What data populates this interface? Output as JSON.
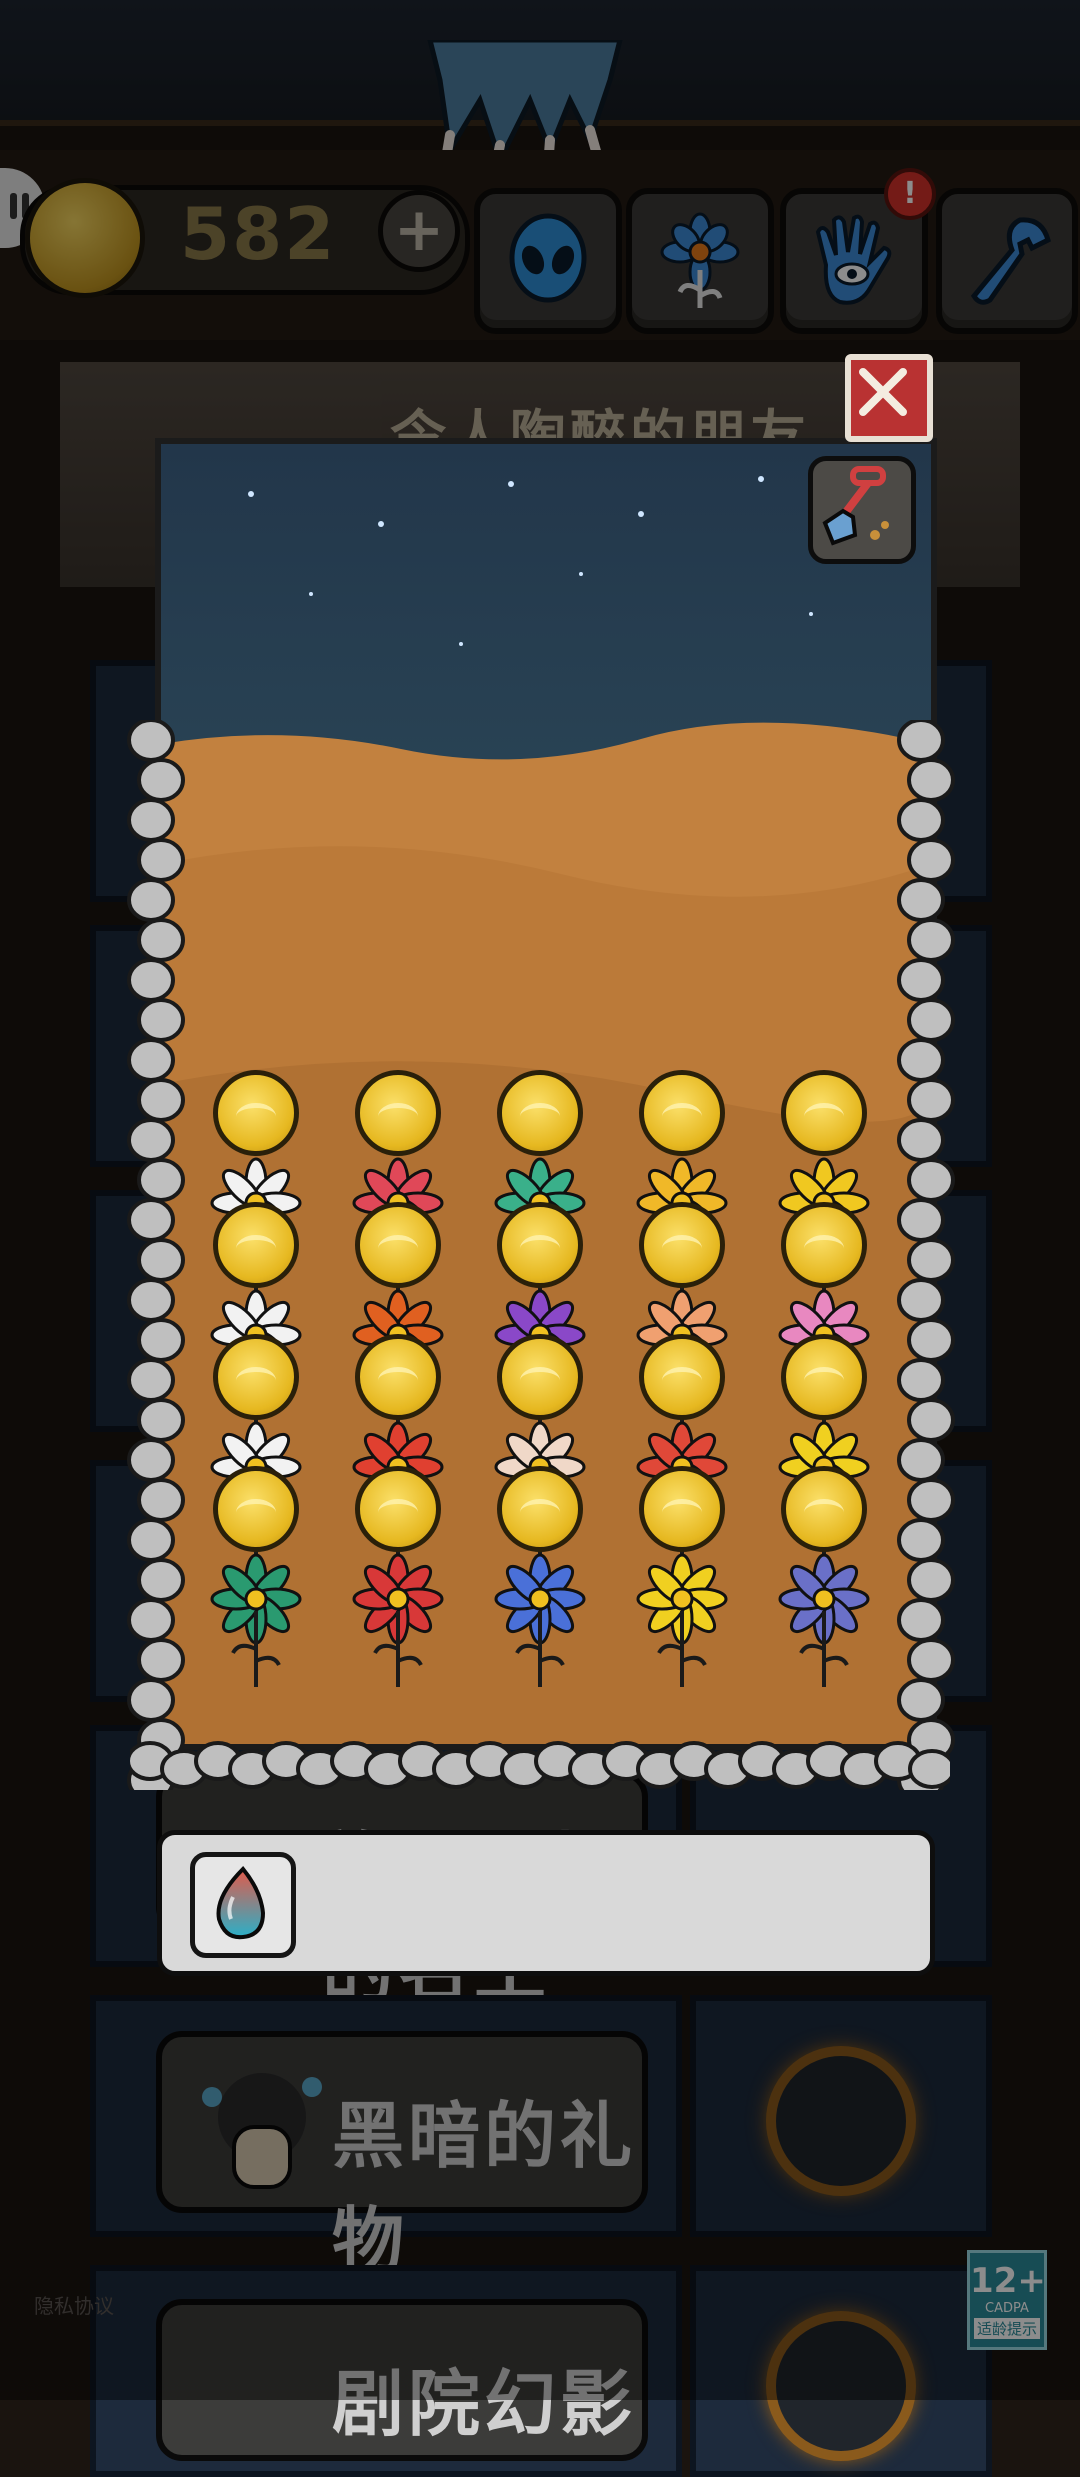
{
  "hud": {
    "coin_count": "582",
    "plus_label": "+",
    "alert_label": "!",
    "buttons": [
      "alien-icon",
      "flower-icon",
      "palm-eye-icon",
      "wrench-icon"
    ]
  },
  "background": {
    "banner_title": "令人陶醉的朋友",
    "cards": [
      {
        "title": "施工现场的名工"
      },
      {
        "title": "黑暗的礼物"
      },
      {
        "title": "剧院幻影"
      }
    ],
    "privacy_label": "隐私协议",
    "age_rating": {
      "value": "12+",
      "brand": "CADPA",
      "label": "适龄提示"
    }
  },
  "garden": {
    "rows": 4,
    "columns": 5
  },
  "colors": {
    "coin": "#e6b820",
    "desert": "#b7783f",
    "night_sky": "#22364a",
    "close": "#b93232"
  }
}
